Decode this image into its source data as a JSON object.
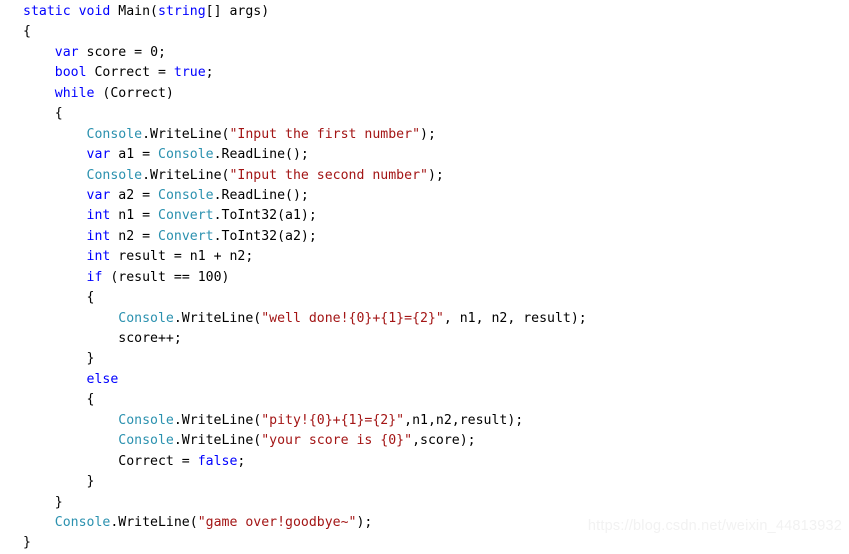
{
  "editor": {
    "language": "C#",
    "background_color": "#ffffff",
    "colors": {
      "keyword": "#0000ff",
      "type": "#2b91af",
      "string": "#a31515",
      "plain": "#000000",
      "watermark": "#f2f2f2"
    }
  },
  "watermark": {
    "text": "https://blog.csdn.net/weixin_44813932"
  },
  "code": {
    "full_text": "    static void Main(string[] args)\n    {\n        var score = 0;\n        bool Correct = true;\n        while (Correct)\n        {\n            Console.WriteLine(\"Input the first number\");\n            var a1 = Console.ReadLine();\n            Console.WriteLine(\"Input the second number\");\n            var a2 = Console.ReadLine();\n            int n1 = Convert.ToInt32(a1);\n            int n2 = Convert.ToInt32(a2);\n            int result = n1 + n2;\n            if (result == 100)\n            {\n                Console.WriteLine(\"well done!{0}+{1}={2}\", n1, n2, result);\n                score++;\n            }\n            else\n            {\n                Console.WriteLine(\"pity!{0}+{1}={2}\",n1,n2,result);\n                Console.WriteLine(\"your score is {0}\",score);\n                Correct = false;\n            }\n        }\n        Console.WriteLine(\"game over!goodbye~\");\n    }",
    "lines": [
      {
        "n": 1,
        "indent": 0,
        "tokens": [
          {
            "t": "kw",
            "v": "static"
          },
          {
            "t": "pln",
            "v": " "
          },
          {
            "t": "kw",
            "v": "void"
          },
          {
            "t": "pln",
            "v": " Main("
          },
          {
            "t": "kw",
            "v": "string"
          },
          {
            "t": "pln",
            "v": "[] args)"
          }
        ]
      },
      {
        "n": 2,
        "indent": 0,
        "tokens": [
          {
            "t": "pln",
            "v": "{"
          }
        ]
      },
      {
        "n": 3,
        "indent": 1,
        "tokens": [
          {
            "t": "kw",
            "v": "var"
          },
          {
            "t": "pln",
            "v": " score = "
          },
          {
            "t": "num",
            "v": "0"
          },
          {
            "t": "pln",
            "v": ";"
          }
        ]
      },
      {
        "n": 4,
        "indent": 1,
        "tokens": [
          {
            "t": "kw",
            "v": "bool"
          },
          {
            "t": "pln",
            "v": " Correct = "
          },
          {
            "t": "kw",
            "v": "true"
          },
          {
            "t": "pln",
            "v": ";"
          }
        ]
      },
      {
        "n": 5,
        "indent": 1,
        "tokens": [
          {
            "t": "kw",
            "v": "while"
          },
          {
            "t": "pln",
            "v": " (Correct)"
          }
        ]
      },
      {
        "n": 6,
        "indent": 1,
        "tokens": [
          {
            "t": "pln",
            "v": "{"
          }
        ]
      },
      {
        "n": 7,
        "indent": 2,
        "tokens": [
          {
            "t": "type",
            "v": "Console"
          },
          {
            "t": "pln",
            "v": ".WriteLine("
          },
          {
            "t": "str",
            "v": "\"Input the first number\""
          },
          {
            "t": "pln",
            "v": ");"
          }
        ]
      },
      {
        "n": 8,
        "indent": 2,
        "tokens": [
          {
            "t": "kw",
            "v": "var"
          },
          {
            "t": "pln",
            "v": " a1 = "
          },
          {
            "t": "type",
            "v": "Console"
          },
          {
            "t": "pln",
            "v": ".ReadLine();"
          }
        ]
      },
      {
        "n": 9,
        "indent": 2,
        "tokens": [
          {
            "t": "type",
            "v": "Console"
          },
          {
            "t": "pln",
            "v": ".WriteLine("
          },
          {
            "t": "str",
            "v": "\"Input the second number\""
          },
          {
            "t": "pln",
            "v": ");"
          }
        ]
      },
      {
        "n": 10,
        "indent": 2,
        "tokens": [
          {
            "t": "kw",
            "v": "var"
          },
          {
            "t": "pln",
            "v": " a2 = "
          },
          {
            "t": "type",
            "v": "Console"
          },
          {
            "t": "pln",
            "v": ".ReadLine();"
          }
        ]
      },
      {
        "n": 11,
        "indent": 2,
        "tokens": [
          {
            "t": "kw",
            "v": "int"
          },
          {
            "t": "pln",
            "v": " n1 = "
          },
          {
            "t": "type",
            "v": "Convert"
          },
          {
            "t": "pln",
            "v": ".ToInt32(a1);"
          }
        ]
      },
      {
        "n": 12,
        "indent": 2,
        "tokens": [
          {
            "t": "kw",
            "v": "int"
          },
          {
            "t": "pln",
            "v": " n2 = "
          },
          {
            "t": "type",
            "v": "Convert"
          },
          {
            "t": "pln",
            "v": ".ToInt32(a2);"
          }
        ]
      },
      {
        "n": 13,
        "indent": 2,
        "tokens": [
          {
            "t": "kw",
            "v": "int"
          },
          {
            "t": "pln",
            "v": " result = n1 + n2;"
          }
        ]
      },
      {
        "n": 14,
        "indent": 2,
        "tokens": [
          {
            "t": "kw",
            "v": "if"
          },
          {
            "t": "pln",
            "v": " (result == "
          },
          {
            "t": "num",
            "v": "100"
          },
          {
            "t": "pln",
            "v": ")"
          }
        ]
      },
      {
        "n": 15,
        "indent": 2,
        "tokens": [
          {
            "t": "pln",
            "v": "{"
          }
        ]
      },
      {
        "n": 16,
        "indent": 3,
        "tokens": [
          {
            "t": "type",
            "v": "Console"
          },
          {
            "t": "pln",
            "v": ".WriteLine("
          },
          {
            "t": "str",
            "v": "\"well done!{0}+{1}={2}\""
          },
          {
            "t": "pln",
            "v": ", n1, n2, result);"
          }
        ]
      },
      {
        "n": 17,
        "indent": 3,
        "tokens": [
          {
            "t": "pln",
            "v": "score++;"
          }
        ]
      },
      {
        "n": 18,
        "indent": 2,
        "tokens": [
          {
            "t": "pln",
            "v": "}"
          }
        ]
      },
      {
        "n": 19,
        "indent": 2,
        "tokens": [
          {
            "t": "kw",
            "v": "else"
          }
        ]
      },
      {
        "n": 20,
        "indent": 2,
        "tokens": [
          {
            "t": "pln",
            "v": "{"
          }
        ]
      },
      {
        "n": 21,
        "indent": 3,
        "tokens": [
          {
            "t": "type",
            "v": "Console"
          },
          {
            "t": "pln",
            "v": ".WriteLine("
          },
          {
            "t": "str",
            "v": "\"pity!{0}+{1}={2}\""
          },
          {
            "t": "pln",
            "v": ",n1,n2,result);"
          }
        ]
      },
      {
        "n": 22,
        "indent": 3,
        "tokens": [
          {
            "t": "type",
            "v": "Console"
          },
          {
            "t": "pln",
            "v": ".WriteLine("
          },
          {
            "t": "str",
            "v": "\"your score is {0}\""
          },
          {
            "t": "pln",
            "v": ",score);"
          }
        ]
      },
      {
        "n": 23,
        "indent": 3,
        "tokens": [
          {
            "t": "pln",
            "v": "Correct = "
          },
          {
            "t": "kw",
            "v": "false"
          },
          {
            "t": "pln",
            "v": ";"
          }
        ]
      },
      {
        "n": 24,
        "indent": 2,
        "tokens": [
          {
            "t": "pln",
            "v": "}"
          }
        ]
      },
      {
        "n": 25,
        "indent": 1,
        "tokens": [
          {
            "t": "pln",
            "v": "}"
          }
        ]
      },
      {
        "n": 26,
        "indent": 1,
        "tokens": [
          {
            "t": "type",
            "v": "Console"
          },
          {
            "t": "pln",
            "v": ".WriteLine("
          },
          {
            "t": "str",
            "v": "\"game over!goodbye~\""
          },
          {
            "t": "pln",
            "v": ");"
          }
        ]
      },
      {
        "n": 27,
        "indent": 0,
        "tokens": [
          {
            "t": "pln",
            "v": "}"
          }
        ]
      }
    ]
  }
}
